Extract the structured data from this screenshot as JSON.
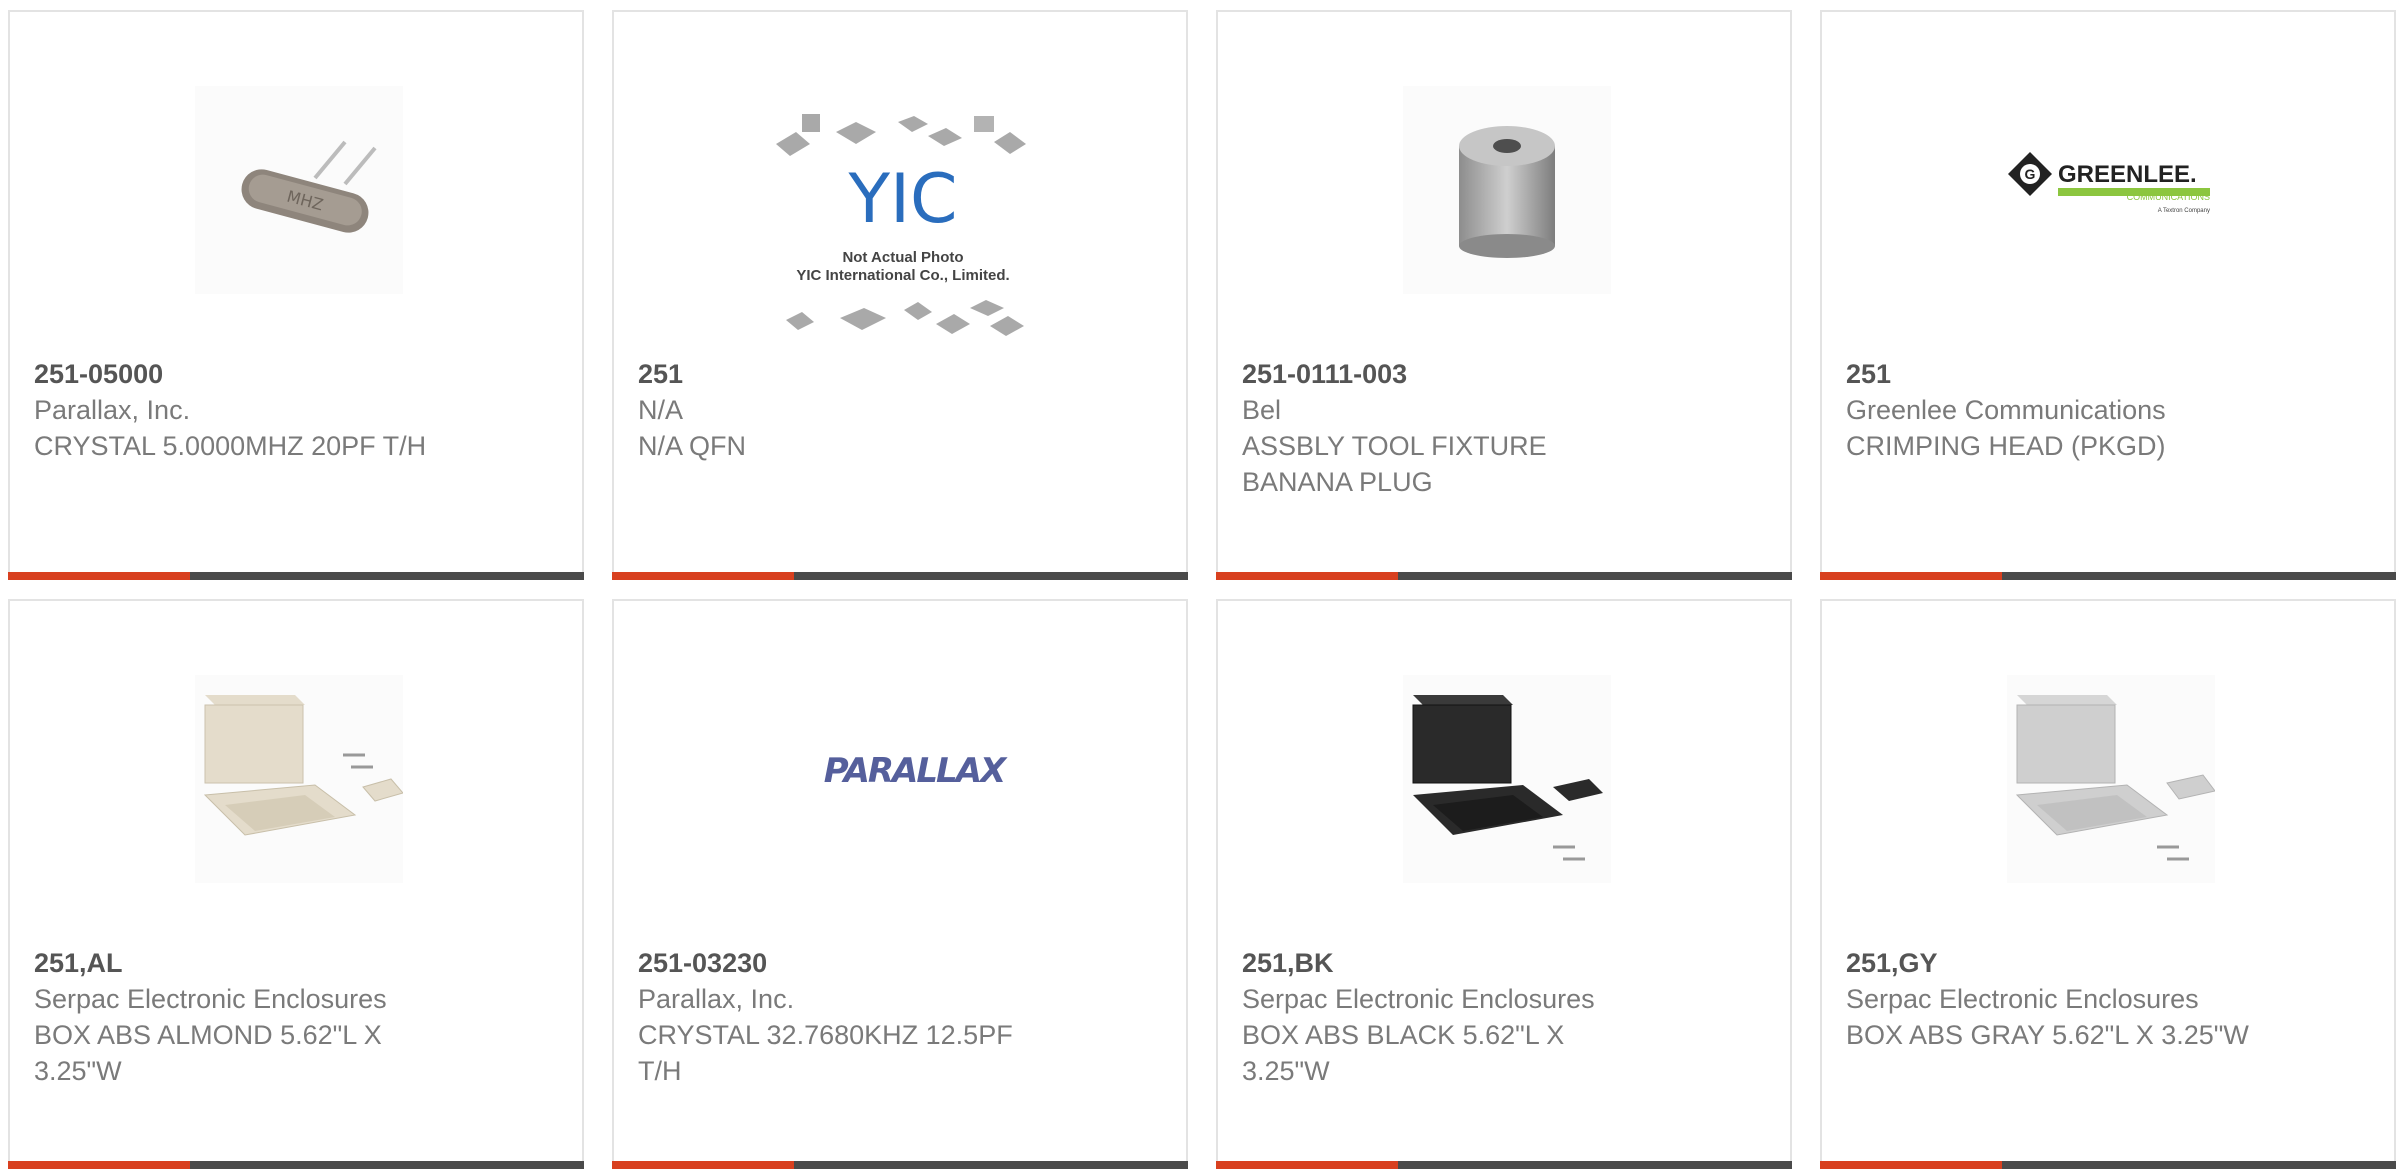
{
  "products": [
    {
      "part_number": "251-05000",
      "manufacturer": "Parallax, Inc.",
      "description": "CRYSTAL 5.0000MHZ 20PF T/H",
      "image": "crystal-icon"
    },
    {
      "part_number": "251",
      "manufacturer": "N/A",
      "description": "N/A QFN",
      "image": "not-actual-photo-icon",
      "image_text": {
        "logo": "YIC",
        "line1": "Not Actual Photo",
        "line2": "YIC International Co., Limited."
      }
    },
    {
      "part_number": "251-0111-003",
      "manufacturer": "Bel",
      "description": "ASSBLY TOOL FIXTURE BANANA PLUG",
      "image": "cylinder-fixture-icon"
    },
    {
      "part_number": "251",
      "manufacturer": "Greenlee Communications",
      "description": "CRIMPING HEAD (PKGD)",
      "image": "greenlee-logo",
      "image_text": {
        "brand": "GREENLEE.",
        "sub": "COMMUNICATIONS",
        "tag": "A Textron Company"
      }
    },
    {
      "part_number": "251,AL",
      "manufacturer": "Serpac Electronic Enclosures",
      "description": "BOX ABS ALMOND 5.62\"L X 3.25\"W",
      "image": "enclosure-box-icon"
    },
    {
      "part_number": "251-03230",
      "manufacturer": "Parallax, Inc.",
      "description": "CRYSTAL 32.7680KHZ 12.5PF T/H",
      "image": "parallax-logo",
      "image_text": {
        "brand": "PARALLAX"
      }
    },
    {
      "part_number": "251,BK",
      "manufacturer": "Serpac Electronic Enclosures",
      "description": "BOX ABS BLACK 5.62\"L X 3.25\"W",
      "image": "enclosure-box-icon"
    },
    {
      "part_number": "251,GY",
      "manufacturer": "Serpac Electronic Enclosures",
      "description": "BOX ABS GRAY 5.62\"L X 3.25\"W",
      "image": "enclosure-box-icon"
    }
  ],
  "colors": {
    "accent": "#d8401f",
    "bar": "#4a4a4a",
    "box_almond": "#e4dccb",
    "box_black": "#2a2a2a",
    "box_gray": "#cfcfcf"
  }
}
